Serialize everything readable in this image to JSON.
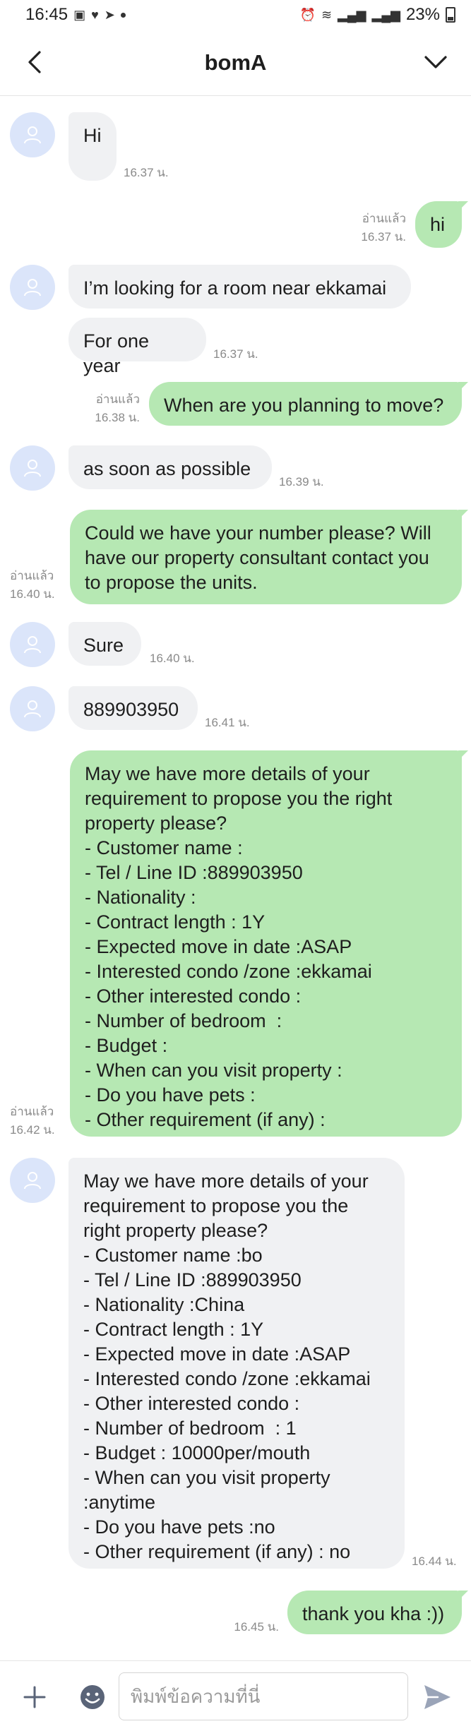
{
  "status_bar": {
    "time": "16:45",
    "battery": "23%"
  },
  "header": {
    "title": "bomA"
  },
  "messages": [
    {
      "text": "Hi",
      "time": "16.37 น."
    },
    {
      "text": "hi",
      "read": "อ่านแล้ว",
      "time": "16.37 น."
    },
    {
      "text": "I’m looking for a room near ekkamai"
    },
    {
      "text": "For one year",
      "time": "16.37 น."
    },
    {
      "text": "When are you planning to move?",
      "read": "อ่านแล้ว",
      "time": "16.38 น."
    },
    {
      "text": "as soon as possible",
      "time": "16.39 น."
    },
    {
      "text": "Could we have your number please? Will\nhave our property consultant contact you\nto propose the units.",
      "read": "อ่านแล้ว",
      "time": "16.40 น."
    },
    {
      "text": "Sure",
      "time": "16.40 น."
    },
    {
      "text": "889903950",
      "time": "16.41 น."
    },
    {
      "text": "May we have more details of your\nrequirement to propose you the right\nproperty please?\n- Customer name :\n- Tel / Line ID :889903950\n- Nationality :\n- Contract length : 1Y\n- Expected move in date :ASAP\n- Interested condo /zone :ekkamai\n- Other interested condo :\n- Number of bedroom  :\n- Budget :\n- When can you visit property :\n- Do you have pets :\n- Other requirement (if any) :",
      "read": "อ่านแล้ว",
      "time": "16.42 น."
    },
    {
      "text": "May we have more details of your\nrequirement to propose you the\nright property please?\n- Customer name :bo\n- Tel / Line ID :889903950\n- Nationality :China\n- Contract length : 1Y\n- Expected move in date :ASAP\n- Interested condo /zone :ekkamai\n- Other interested condo :\n- Number of bedroom  : 1\n- Budget : 10000per/mouth\n- When can you visit property\n:anytime\n- Do you have pets :no\n- Other requirement (if any) : no",
      "time": "16.44 น."
    },
    {
      "text": "thank you kha :))",
      "time": "16.45 น."
    }
  ],
  "input": {
    "placeholder": "พิมพ์ข้อความที่นี่",
    "value": ""
  },
  "colors": {
    "incoming_bubble": "#f0f1f3",
    "outgoing_bubble": "#b6e8b3",
    "avatar_bg": "#dbe5fa",
    "send_icon": "#9aa4b8"
  },
  "icons": {
    "back": "back-arrow-icon",
    "menu": "chevron-down-icon",
    "avatar": "user-icon",
    "add": "plus-icon",
    "emoji": "emoji-icon",
    "send": "send-icon"
  }
}
